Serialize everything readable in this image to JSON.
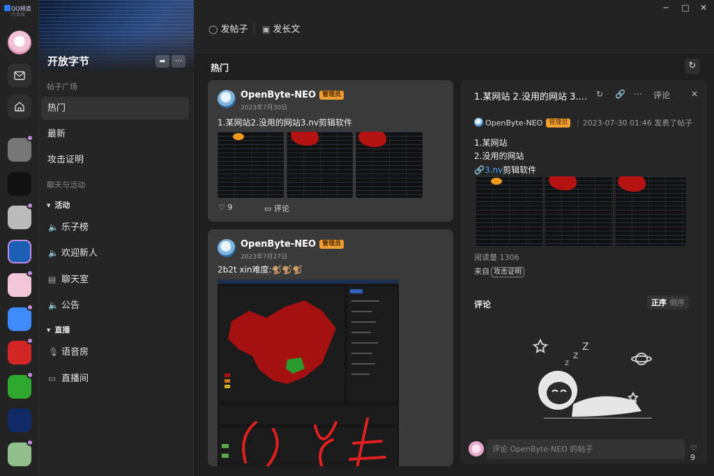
{
  "app": {
    "brand": "QQ频道",
    "brand_sub": "内测版",
    "window_controls": [
      "─",
      "□",
      "✕"
    ]
  },
  "rail": {
    "icons": [
      "mail-icon",
      "home-icon"
    ],
    "guilds": [
      {
        "name": "guild-helmet",
        "color": "#777777",
        "dot": true
      },
      {
        "name": "guild-bird",
        "color": "#111111",
        "dot": false
      },
      {
        "name": "guild-anime-girl",
        "color": "#bbbbbb",
        "dot": true
      },
      {
        "name": "guild-openbyte",
        "color": "#1a5fb4",
        "dot": false,
        "active": true
      },
      {
        "name": "guild-catgirl",
        "color": "#f3c6d8",
        "dot": true
      },
      {
        "name": "guild-robot",
        "color": "#3d8bff",
        "dot": true
      },
      {
        "name": "guild-huawei",
        "color": "#d42525",
        "dot": true
      },
      {
        "name": "guild-creeper",
        "color": "#2fa82f",
        "dot": true
      },
      {
        "name": "guild-v",
        "color": "#0f2a66",
        "dot": false
      },
      {
        "name": "guild-frog",
        "color": "#8fbf8a",
        "dot": true
      }
    ]
  },
  "guild": {
    "name": "开放字节"
  },
  "sidebar": {
    "section_posts": "帖子广场",
    "items": [
      {
        "label": "热门",
        "active": true
      },
      {
        "label": "最新",
        "active": false
      },
      {
        "label": "攻击证明",
        "active": false
      }
    ],
    "section_chat": "聊天与活动",
    "group_activity": "活动",
    "activity_channels": [
      {
        "icon": "speaker-icon",
        "label": "乐子榜"
      },
      {
        "icon": "speaker-icon",
        "label": "欢迎新人"
      },
      {
        "icon": "chat-icon",
        "label": "聊天室"
      },
      {
        "icon": "speaker-icon",
        "label": "公告"
      }
    ],
    "group_live": "直播",
    "live_channels": [
      {
        "icon": "mic-icon",
        "label": "语音房"
      },
      {
        "icon": "video-icon",
        "label": "直播间"
      }
    ]
  },
  "toolbar": {
    "post_label": "发帖子",
    "long_post_label": "发长文"
  },
  "feed": {
    "title": "热门",
    "posts": [
      {
        "author": "OpenByte-NEO",
        "badge": "管理员",
        "date": "2023年7月30日",
        "text": "1.某网站2.没用的网站3.nv剪辑软件",
        "likes": "9",
        "comment_label": "评论"
      },
      {
        "author": "OpenByte-NEO",
        "badge": "管理员",
        "date": "2023年7月27日",
        "text": "2b2t xin难度:🐒🐒🐒"
      }
    ]
  },
  "detail": {
    "title": "1.某网站 2.没用的网站 3....",
    "comment_tool_label": "评论",
    "author": "OpenByte-NEO",
    "badge": "管理员",
    "time_action": "2023-07-30 01:46 发表了帖子",
    "lines": [
      "1.某网站",
      "2.没用的网站"
    ],
    "link_text": "3.nv",
    "line3_rest": "剪辑软件",
    "views": "阅读量 1306",
    "from_label": "来自",
    "from_tag": "攻击证明",
    "comments_label": "评论",
    "sort_asc": "正序",
    "sort_desc": "倒序",
    "comment_placeholder": "评论 OpenByte-NEO 的帖子",
    "likes": "9"
  }
}
